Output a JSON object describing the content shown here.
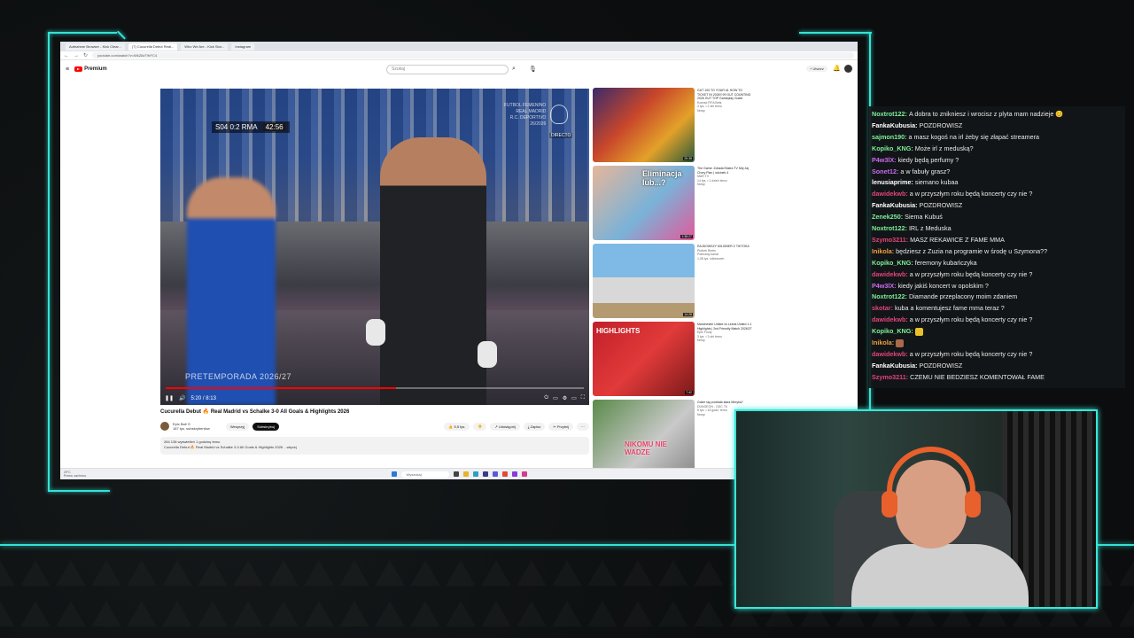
{
  "browser": {
    "tabs": [
      "Aufnahme Browser - Kick Clear...",
      "(7) Cucurella Debut Real...",
      "Who We Are - Kick Stor...",
      "Instagram"
    ],
    "url": "youtube.com/watch?v=WkZ8zT9rFC4"
  },
  "youtube": {
    "logo": "Premium",
    "search_placeholder": "Szukaj",
    "create_label": "+ Utwórz",
    "video": {
      "score_text": "S04 0:2 RMA",
      "match_time": "42:56",
      "watermark": [
        "FUTBOL FEMENINO",
        "REAL MADRID",
        "R.C. DEPORTIVO",
        "26/2026"
      ],
      "live_badge": "DIRECTO",
      "overlay_text": "PRETEMPORADA 2026/27",
      "time": "5:20 / 8:13",
      "progress": 0.55
    },
    "title": "Cucurella Debut 🔥 Real Madrid vs Schalke 3-0 All Goals & Highlights 2026",
    "channel": {
      "name": "Epic Ball ⊙",
      "subs": "187 tys. subskrybentów"
    },
    "join_label": "Wesprzyj",
    "subscribe_label": "Subskrybuj",
    "actions": [
      "👍 5,5 tys.",
      "👎",
      "↗ Udostępnij",
      "⤓ Zapisz",
      "✂ Przytnij",
      "⋯"
    ],
    "description": [
      "284 138 wyświetleń  1 godzinę temu",
      "Cucurella Debut 🔥 Real Madrid vs Schalke 3-0 All Goals & Highlights 2026 ...więcej"
    ],
    "related": [
      {
        "title": "GUT 100 TO YOUR #1 HOW TO TICKET IN 2026!! 99 GUT COUNTING 2026 GUT TOP Gameplay Guide",
        "channel": "Konrad FIFA Bets",
        "meta": "4 tys. • 2 dni temu",
        "duration": "25:38",
        "badge": "Nowy"
      },
      {
        "title": "The Game: Zdrada Ekstra TV Mój Jaj Chory Plan | odcinek 4",
        "channel": "MAR TV",
        "meta": "14 tys. • 1 dzień temu",
        "duration": "1:38:27",
        "badge": "Nowy",
        "thumb_text": "Eliminacja lub...?"
      },
      {
        "title": "RAJDOWSZY MILIONER Z TIKTOKA",
        "channel": "Piotrek Reels",
        "meta": "Polecany kanał",
        "duration": "14:28",
        "badge": "1,08 tys. odtworzeń"
      },
      {
        "title": "Manchester United vs Leeds United 1-1 Highlights | 2nd Friendly Match 2026/27",
        "channel": "Epic Footy",
        "meta": "3 tys. • 3 dni temu",
        "duration": "7:42",
        "badge": "Nowy",
        "thumb_text": "HIGHLIGHTS"
      },
      {
        "title": "Gdzie się podziała stara Meryka?",
        "channel": "DUNGEON - ODC 76",
        "meta": "5 tys. • 16 godz. temu",
        "duration": "18:12",
        "badge": "Nowy",
        "thumb_text": "NIKOMU NIE WADZE"
      }
    ],
    "taskbar_search": "Wyszukaj",
    "taskbar_weather": [
      "29°C",
      "Przew. zachmur."
    ]
  },
  "chat": [
    {
      "user": "Noxtrot122",
      "color": "#7cf09a",
      "text": "A dobra to znikniesz i wrocisz z plyta mam nadzieje 😊"
    },
    {
      "user": "FankaKubusia",
      "color": "#ffffff",
      "text": "POZDROWISZ"
    },
    {
      "user": "sajmon190",
      "color": "#7cf09a",
      "text": "a masz kogoś na irl żeby się złapać streamera"
    },
    {
      "user": "Kopiko_KNG",
      "color": "#7cf09a",
      "text": "Może irl z meduską?"
    },
    {
      "user": "P4w3lX",
      "color": "#c86cf0",
      "text": "kiedy będą perfumy ?"
    },
    {
      "user": "Sonet12",
      "color": "#c86cf0",
      "text": "a w fabuły grasz?"
    },
    {
      "user": "lenusiaprime",
      "color": "#ffffff",
      "text": "siemano kubaa"
    },
    {
      "user": "dawidekwb",
      "color": "#e0457b",
      "text": "a w przyszłym roku będą koncerty czy nie ?"
    },
    {
      "user": "FankaKubusia",
      "color": "#ffffff",
      "text": "POZDROWISZ"
    },
    {
      "user": "Zenek250",
      "color": "#7cf09a",
      "text": "Siema Kubuś"
    },
    {
      "user": "Noxtrot122",
      "color": "#7cf09a",
      "text": "IRL z Meduska"
    },
    {
      "user": "Szymo3211",
      "color": "#e0457b",
      "text": "MASZ REKAWICE Z FAME MMA"
    },
    {
      "user": "Inikola",
      "color": "#f0a040",
      "text": "będziesz z Zuzia na programie w środę u Szymona??"
    },
    {
      "user": "Kopiko_KNG",
      "color": "#7cf09a",
      "text": "feremony kubańczyka"
    },
    {
      "user": "dawidekwb",
      "color": "#e0457b",
      "text": "a w przyszłym roku będą koncerty czy nie ?"
    },
    {
      "user": "P4w3lX",
      "color": "#c86cf0",
      "text": "kiedy jakiś koncert w opolskim ?"
    },
    {
      "user": "Noxtrot122",
      "color": "#7cf09a",
      "text": "Diamande przeplacony moim zdaniem"
    },
    {
      "user": "skotar",
      "color": "#e0457b",
      "text": "kuba a komentujesz fame mma teraz ?"
    },
    {
      "user": "dawidekwb",
      "color": "#e0457b",
      "text": "a w przyszłym roku będą koncerty czy nie ?"
    },
    {
      "user": "Kopiko_KNG",
      "color": "#7cf09a",
      "text": ""
    },
    {
      "user": "Inikola",
      "color": "#f0a040",
      "text": ""
    },
    {
      "user": "dawidekwb",
      "color": "#e0457b",
      "text": "a w przyszłym roku będą koncerty czy nie ?"
    },
    {
      "user": "FankaKubusia",
      "color": "#ffffff",
      "text": "POZDROWISZ"
    },
    {
      "user": "Szymo3211",
      "color": "#e0457b",
      "text": "CZEMU NIE BEDZIESZ KOMENTOWAŁ FAME"
    }
  ]
}
